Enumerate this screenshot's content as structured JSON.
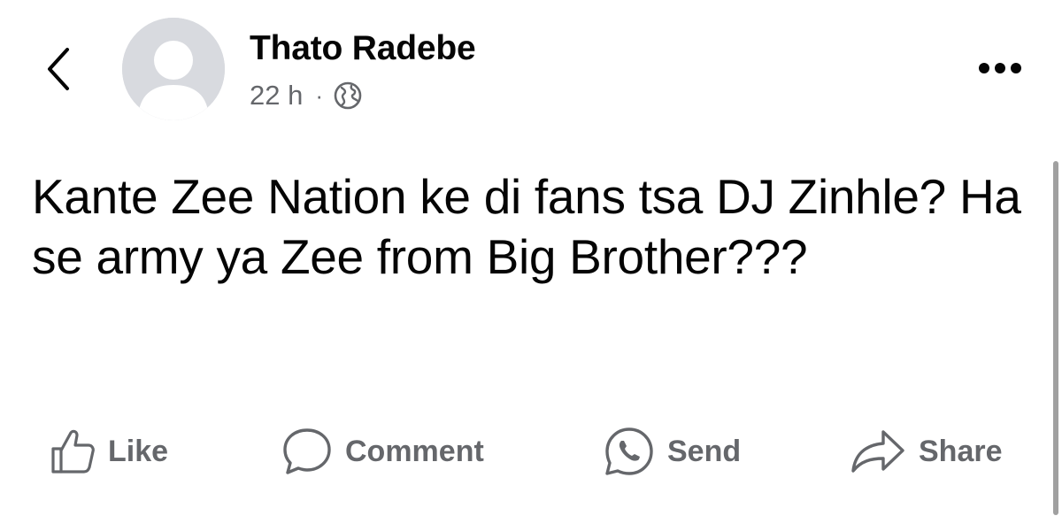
{
  "post": {
    "author": "Thato Radebe",
    "time": "22 h",
    "separator": "·",
    "audience_icon": "globe-icon",
    "text": "Kante Zee Nation ke di fans tsa DJ Zinhle? Ha se army ya Zee from Big Brother???"
  },
  "actions": {
    "like": "Like",
    "comment": "Comment",
    "send": "Send",
    "share": "Share"
  },
  "icons": {
    "back": "chevron-left-icon",
    "more": "more-options-icon",
    "like": "thumbs-up-icon",
    "comment": "comment-bubble-icon",
    "send": "whatsapp-icon",
    "share": "share-arrow-icon"
  },
  "colors": {
    "text_primary": "#050505",
    "text_secondary": "#65676b",
    "avatar_bg": "#d8dadf",
    "background": "#ffffff"
  }
}
